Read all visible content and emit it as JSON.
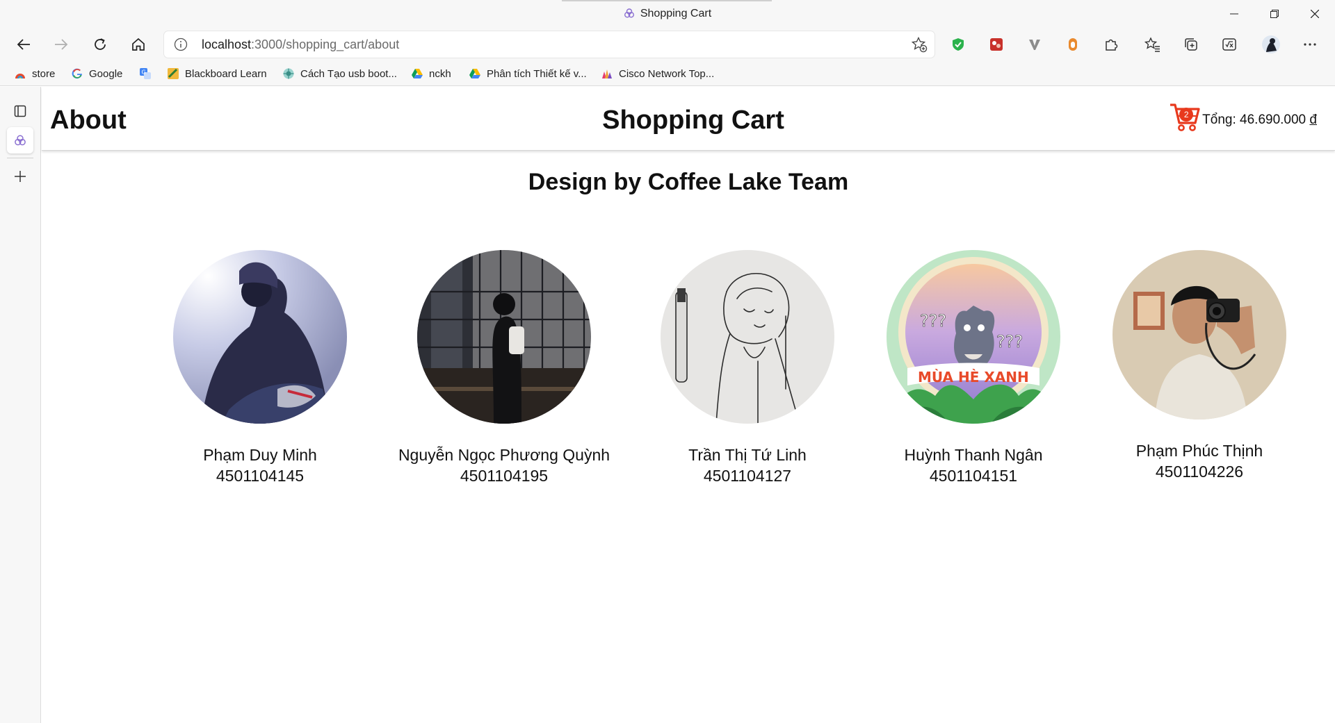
{
  "window": {
    "title": "Shopping Cart"
  },
  "address_bar": {
    "host": "localhost",
    "path": ":3000/shopping_cart/about"
  },
  "bookmarks": [
    {
      "label": "store",
      "icon": "store-icon"
    },
    {
      "label": "Google",
      "icon": "google-icon"
    },
    {
      "label": "",
      "icon": "translate-icon"
    },
    {
      "label": "Blackboard Learn",
      "icon": "blackboard-icon"
    },
    {
      "label": "Cách Tạo usb boot...",
      "icon": "usb-icon"
    },
    {
      "label": "nckh",
      "icon": "drive-icon"
    },
    {
      "label": "Phân tích Thiết kế v...",
      "icon": "drive-icon"
    },
    {
      "label": "Cisco Network Top...",
      "icon": "cisco-icon"
    }
  ],
  "header": {
    "left_title": "About",
    "center_title": "Shopping Cart",
    "cart_count": "2",
    "cart_total": "Tổng: 46.690.000 ",
    "currency": "đ"
  },
  "main": {
    "heading": "Design by Coffee Lake Team",
    "members": [
      {
        "name": "Phạm Duy Minh",
        "id": "4501104145"
      },
      {
        "name": "Nguyễn Ngọc Phương Quỳnh",
        "id": "4501104195"
      },
      {
        "name": "Trần Thị Tứ Linh",
        "id": "4501104127"
      },
      {
        "name": "Huỳnh Thanh Ngân",
        "id": "4501104151"
      },
      {
        "name": "Phạm Phúc Thịnh",
        "id": "4501104226"
      }
    ],
    "photo4_text": {
      "q1": "???",
      "q2": "???",
      "banner": "MÙA HÈ XANH"
    }
  },
  "colors": {
    "accent": "#e8391d",
    "chrome_bg": "#f7f7f7"
  }
}
